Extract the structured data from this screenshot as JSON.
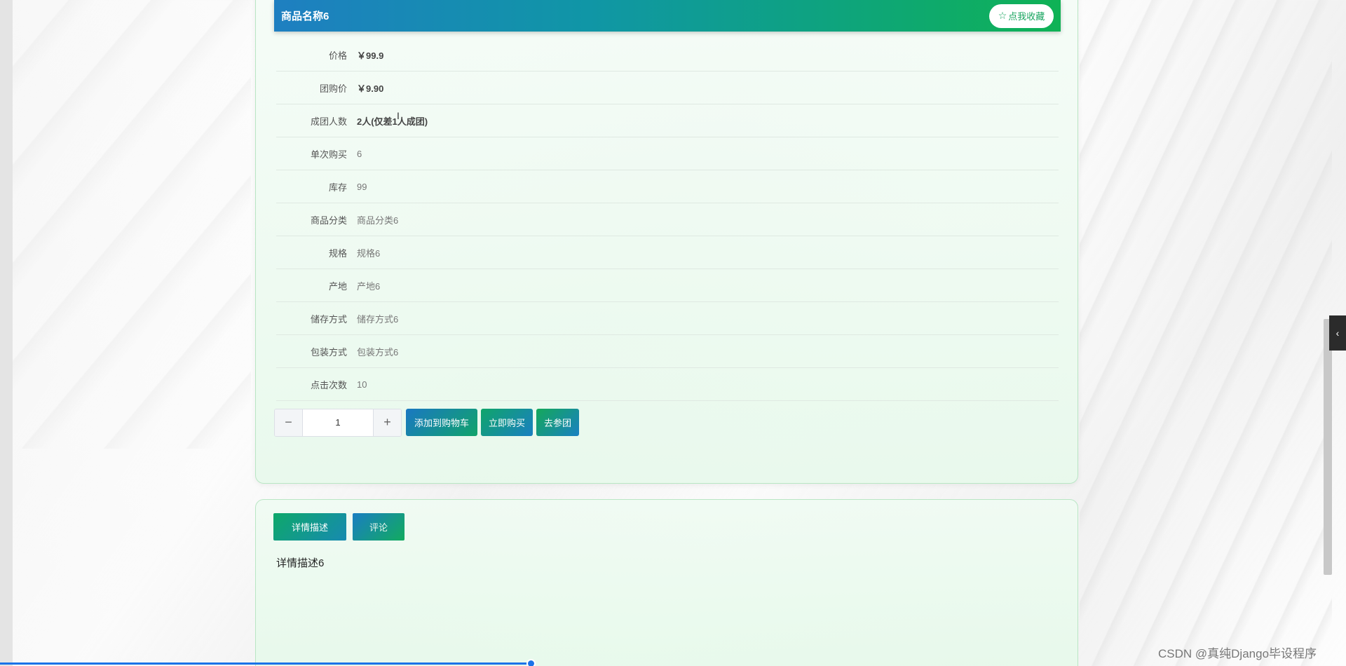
{
  "product": {
    "title": "商品名称6",
    "favorite_label": "点我收藏",
    "favorite_icon": "star-outline-icon"
  },
  "fields": [
    {
      "label": "价格",
      "value": "￥99.9",
      "bold": true
    },
    {
      "label": "团购价",
      "value": "￥9.90",
      "bold": true
    },
    {
      "label": "成团人数",
      "value": "2人(仅差1人成团)",
      "bold": true
    },
    {
      "label": "单次购买",
      "value": "6",
      "bold": false
    },
    {
      "label": "库存",
      "value": "99",
      "bold": false
    },
    {
      "label": "商品分类",
      "value": "商品分类6",
      "bold": false
    },
    {
      "label": "规格",
      "value": "规格6",
      "bold": false
    },
    {
      "label": "产地",
      "value": "产地6",
      "bold": false
    },
    {
      "label": "储存方式",
      "value": "储存方式6",
      "bold": false
    },
    {
      "label": "包装方式",
      "value": "包装方式6",
      "bold": false
    },
    {
      "label": "点击次数",
      "value": "10",
      "bold": false
    }
  ],
  "quantity": {
    "value": "1",
    "minus": "−",
    "plus": "+"
  },
  "actions": {
    "add_to_cart": "添加到购物车",
    "buy_now": "立即购买",
    "join_group": "去参团"
  },
  "detail": {
    "tabs": [
      {
        "label": "详情描述",
        "active": true
      },
      {
        "label": "评论",
        "active": false
      }
    ],
    "content": "详情描述6"
  },
  "side_toggle_icon": "‹",
  "watermark": "CSDN @真纯Django毕设程序",
  "colors": {
    "accent_green": "#15a35d",
    "accent_blue": "#1a78c2",
    "progress_blue": "#1a73e8"
  }
}
